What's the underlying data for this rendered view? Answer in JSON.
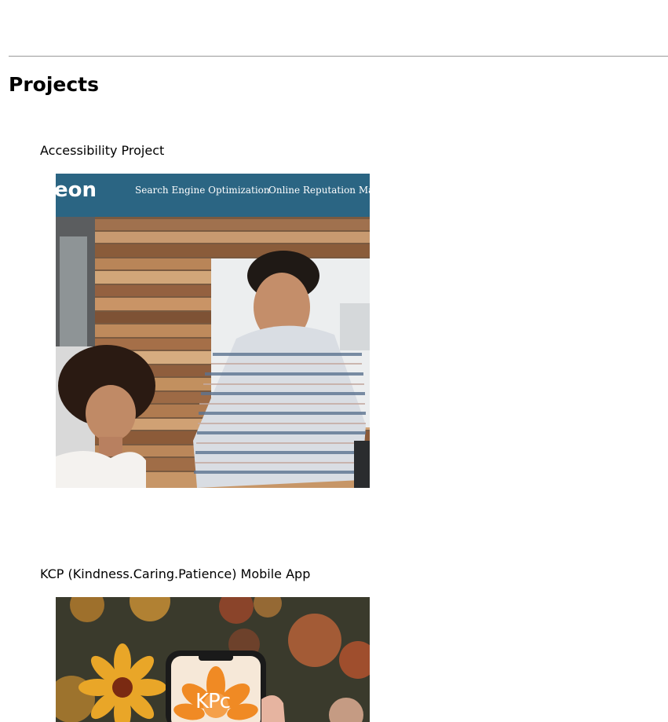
{
  "section": {
    "title": "Projects"
  },
  "projects": [
    {
      "title": "Accessibility Project",
      "thumbnail": {
        "brand_text": "eon",
        "nav_items": [
          "Search Engine Optimization",
          "Online Reputation Mana"
        ],
        "header_color": "#2b6583"
      }
    },
    {
      "title": "KCP (Kindness.Caring.Patience) Mobile App",
      "thumbnail": {
        "logo_text": "KPc",
        "accent_color": "#f08a24"
      }
    }
  ]
}
